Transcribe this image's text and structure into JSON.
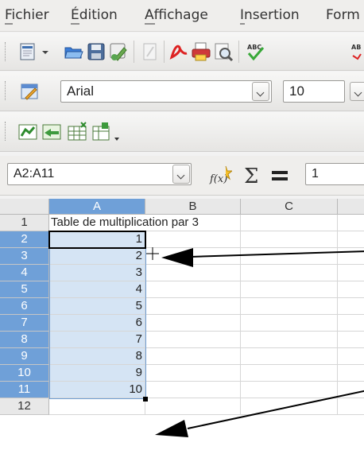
{
  "menu": {
    "items": [
      "Fichier",
      "Édition",
      "Affichage",
      "Insertion",
      "Form"
    ]
  },
  "font_toolbar": {
    "font_name": "Arial",
    "font_size": "10"
  },
  "formula_bar": {
    "name_box": "A2:A11",
    "formula_value": "1"
  },
  "sheet": {
    "columns": [
      "A",
      "B",
      "C"
    ],
    "selected_column": "A",
    "title_cell": "Table de multiplication par 3",
    "rows": [
      "1",
      "2",
      "3",
      "4",
      "5",
      "6",
      "7",
      "8",
      "9",
      "10",
      "11",
      "12"
    ],
    "values": [
      "1",
      "2",
      "3",
      "4",
      "5",
      "6",
      "7",
      "8",
      "9",
      "10"
    ]
  },
  "colors": {
    "selection_header": "#6fa0d8",
    "selection_fill": "#d5e4f4"
  }
}
